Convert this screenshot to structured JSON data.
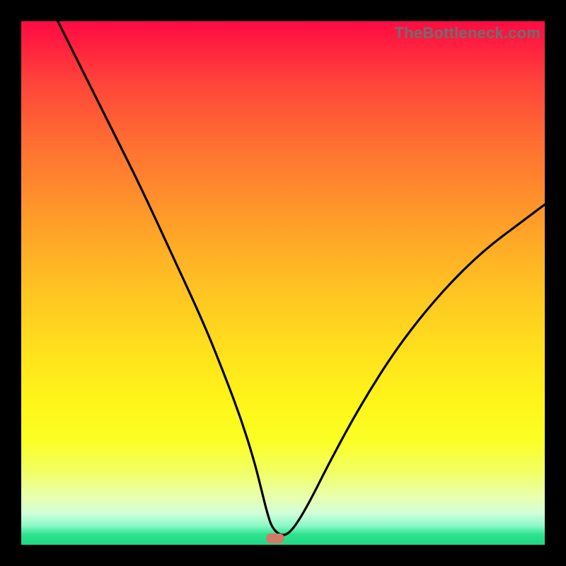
{
  "watermark": "TheBottleneck.com",
  "chart_data": {
    "type": "line",
    "title": "",
    "xlabel": "",
    "ylabel": "",
    "xlim": [
      0,
      100
    ],
    "ylim": [
      0,
      100
    ],
    "series": [
      {
        "name": "curve",
        "x": [
          7,
          12,
          17,
          23,
          29,
          35,
          39,
          42,
          44.5,
          46,
          47,
          48,
          50,
          52,
          55,
          59,
          65,
          72,
          80,
          88,
          96,
          100
        ],
        "y": [
          100,
          90,
          80,
          68,
          55,
          42,
          32,
          24,
          16,
          10,
          6,
          3,
          1.5,
          3,
          8,
          16,
          27,
          38,
          48,
          56,
          62,
          65
        ]
      }
    ],
    "marker": {
      "x": 48.5,
      "y": 1.2,
      "color": "#d17a68"
    },
    "background_gradient": {
      "top": "#ff0b44",
      "bottom": "#1fd884"
    }
  }
}
